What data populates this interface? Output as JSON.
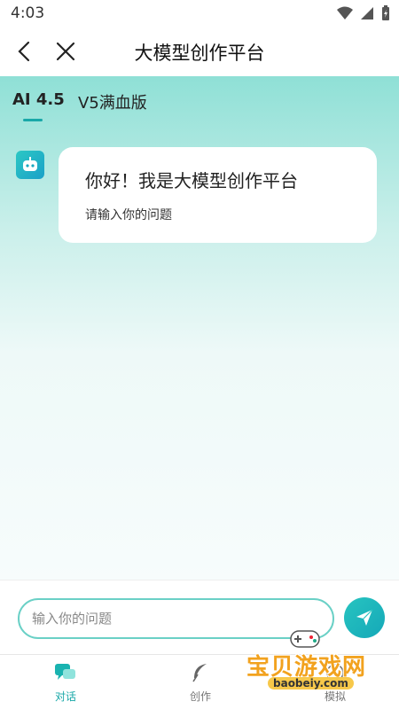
{
  "status": {
    "time": "4:03"
  },
  "header": {
    "title": "大模型创作平台"
  },
  "tabs": [
    {
      "label": "AI 4.5",
      "active": true
    },
    {
      "label": "V5满血版",
      "active": false
    }
  ],
  "message": {
    "title": "你好！我是大模型创作平台",
    "subtitle": "请输入你的问题"
  },
  "input": {
    "placeholder": "输入你的问题",
    "value": ""
  },
  "nav": [
    {
      "label": "对话",
      "icon": "chat-icon",
      "active": true
    },
    {
      "label": "创作",
      "icon": "feather-icon",
      "active": false
    },
    {
      "label": "模拟",
      "icon": "simulate-icon",
      "active": false
    }
  ],
  "watermark": {
    "text": "宝贝游戏网",
    "url": "baobeiy.com"
  },
  "colors": {
    "accent": "#19a8a8",
    "gradient_top": "#8fe0d6",
    "send": "#27c4c0"
  }
}
